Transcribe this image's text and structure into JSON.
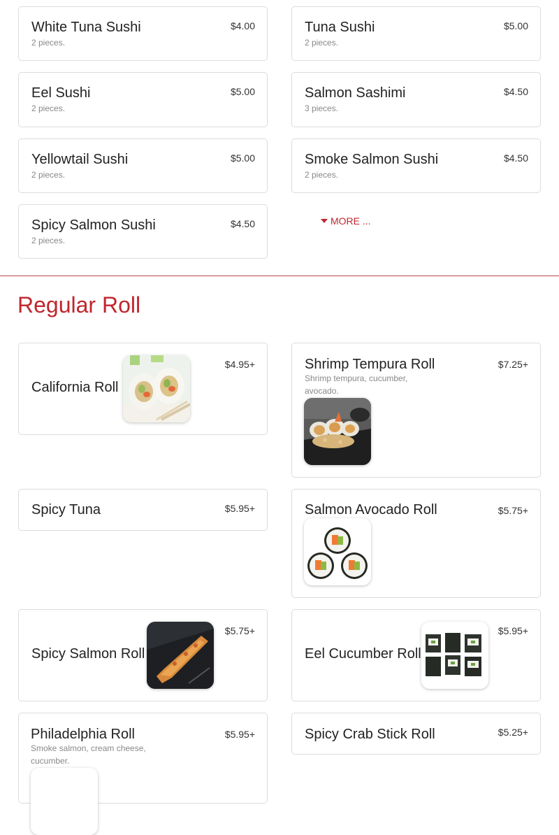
{
  "colors": {
    "accent": "#c0262d",
    "divider": "#b7474a",
    "card_border": "#dcdcdc"
  },
  "sushi_items": [
    {
      "name": "White Tuna Sushi",
      "desc": "2 pieces.",
      "price": "$4.00"
    },
    {
      "name": "Tuna Sushi",
      "desc": "2 pieces.",
      "price": "$5.00"
    },
    {
      "name": "Eel Sushi",
      "desc": "2 pieces.",
      "price": "$5.00"
    },
    {
      "name": "Salmon Sashimi",
      "desc": "3 pieces.",
      "price": "$4.50"
    },
    {
      "name": "Yellowtail Sushi",
      "desc": "2 pieces.",
      "price": "$5.00"
    },
    {
      "name": "Smoke Salmon Sushi",
      "desc": "2 pieces.",
      "price": "$4.50"
    },
    {
      "name": "Spicy Salmon Sushi",
      "desc": "2 pieces.",
      "price": "$4.50"
    }
  ],
  "more": {
    "label": "MORE ...",
    "icon": "caret-down-icon"
  },
  "section": {
    "title": "Regular Roll"
  },
  "roll_items": [
    {
      "name": "California Roll",
      "price": "$4.95+",
      "image": "california-roll-image"
    },
    {
      "name": "Shrimp Tempura Roll",
      "desc": "Shrimp tempura, cucumber, avocado.",
      "price": "$7.25+",
      "image": "shrimp-tempura-roll-image"
    },
    {
      "name": "Spicy Tuna",
      "price": "$5.95+"
    },
    {
      "name": "Salmon Avocado Roll",
      "price": "$5.75+",
      "image": "salmon-avocado-roll-image"
    },
    {
      "name": "Spicy Salmon Roll",
      "price": "$5.75+",
      "image": "spicy-salmon-roll-image"
    },
    {
      "name": "Eel Cucumber Roll",
      "price": "$5.95+",
      "image": "eel-cucumber-roll-image"
    },
    {
      "name": "Philadelphia Roll",
      "desc": "Smoke salmon, cream cheese, cucumber.",
      "price": "$5.95+",
      "image": "philadelphia-roll-image"
    },
    {
      "name": "Spicy Crab Stick Roll",
      "price": "$5.25+"
    }
  ]
}
